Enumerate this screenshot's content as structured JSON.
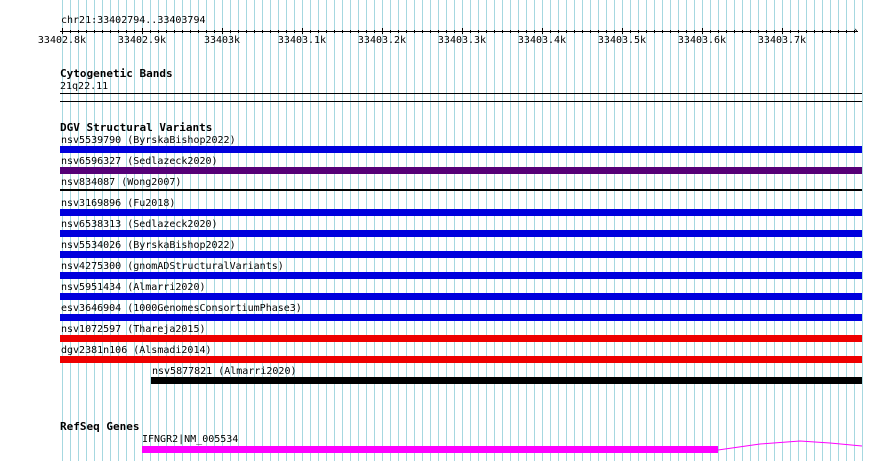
{
  "ruler": {
    "location": "chr21:33402794..33403794",
    "ticks": [
      "33402.8k",
      "33402.9k",
      "33403k",
      "33403.1k",
      "33403.2k",
      "33403.3k",
      "33403.4k",
      "33403.5k",
      "33403.6k",
      "33403.7k"
    ]
  },
  "cytoband": {
    "title": "Cytogenetic Bands",
    "band": "21q22.11"
  },
  "dgv": {
    "title": "DGV Structural Variants",
    "variants": [
      {
        "label": "nsv5539790 (ByrskaBishop2022)",
        "color": "#0000dd"
      },
      {
        "label": "nsv6596327 (Sedlazeck2020)",
        "color": "#550077"
      },
      {
        "label": "nsv834087 (Wong2007)",
        "color": "#000000"
      },
      {
        "label": "nsv3169896 (Fu2018)",
        "color": "#0000dd"
      },
      {
        "label": "nsv6538313 (Sedlazeck2020)",
        "color": "#0000dd"
      },
      {
        "label": "nsv5534026 (ByrskaBishop2022)",
        "color": "#0000dd"
      },
      {
        "label": "nsv4275300 (gnomADStructuralVariants)",
        "color": "#0000dd"
      },
      {
        "label": "nsv5951434 (Almarri2020)",
        "color": "#0000dd"
      },
      {
        "label": "esv3646904 (1000GenomesConsortiumPhase3)",
        "color": "#0000dd"
      },
      {
        "label": "nsv1072597 (Thareja2015)",
        "color": "#ee0000"
      },
      {
        "label": "dgv2381n106 (Alsmadi2014)",
        "color": "#ee0000"
      },
      {
        "label": "nsv5877821 (Almarri2020)",
        "color": "#000000"
      }
    ]
  },
  "refseq": {
    "title": "RefSeq Genes",
    "gene_label": "IFNGR2|NM_005534",
    "exon_color": "#ff00ff"
  },
  "colors": {
    "grid": "#a6d8e0",
    "axis": "#000000"
  }
}
